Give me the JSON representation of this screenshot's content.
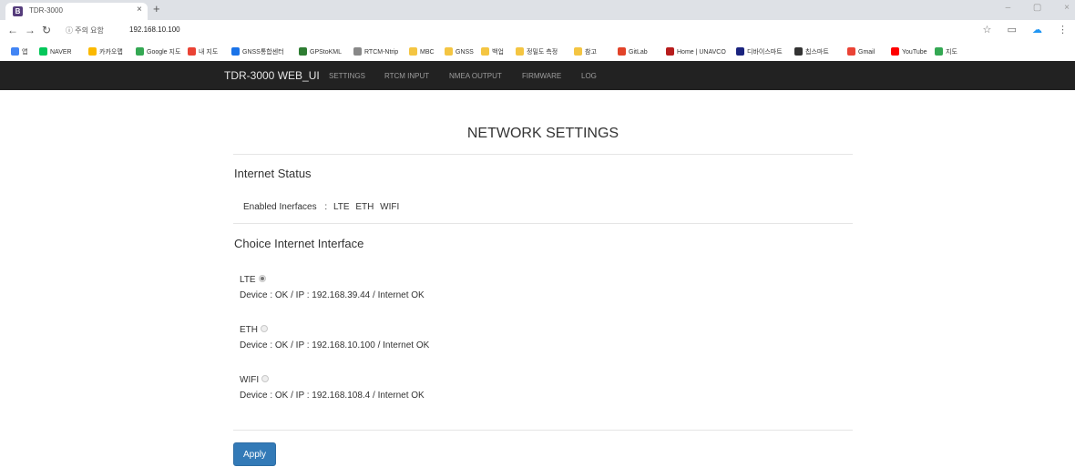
{
  "browser": {
    "tab_title": "TDR-3000",
    "tab_favicon": "B",
    "tab_close": "×",
    "new_tab": "+",
    "window_controls": [
      "–",
      "▢",
      "×"
    ],
    "security_label": "ⓘ 주의 요함",
    "url": "192.168.10.100",
    "bookmarks": [
      {
        "label": "앱",
        "color": "#4285f4"
      },
      {
        "label": "NAVER",
        "color": "#03c75a"
      },
      {
        "label": "카카오맵",
        "color": "#fbb900"
      },
      {
        "label": "Google 지도",
        "color": "#34a853"
      },
      {
        "label": "내 지도",
        "color": "#ea4335"
      },
      {
        "label": "GNSS통합센터",
        "color": "#1a73e8"
      },
      {
        "label": "GPStoKML",
        "color": "#2e7d32"
      },
      {
        "label": "RTCM-Ntrip",
        "color": "#888888"
      },
      {
        "label": "MBC",
        "color": "#f4c542"
      },
      {
        "label": "GNSS",
        "color": "#f4c542"
      },
      {
        "label": "백업",
        "color": "#f4c542"
      },
      {
        "label": "정밀도 측정",
        "color": "#f4c542"
      },
      {
        "label": "참고",
        "color": "#f4c542"
      },
      {
        "label": "GitLab",
        "color": "#e24329"
      },
      {
        "label": "Home | UNAVCO",
        "color": "#b71c1c"
      },
      {
        "label": "디바이스마트",
        "color": "#1a237e"
      },
      {
        "label": "칩스마트",
        "color": "#333333"
      },
      {
        "label": "Gmail",
        "color": "#ea4335"
      },
      {
        "label": "YouTube",
        "color": "#ff0000"
      },
      {
        "label": "지도",
        "color": "#34a853"
      }
    ]
  },
  "navbar": {
    "brand": "TDR-3000 WEB_UI",
    "links": [
      "SETTINGS",
      "RTCM INPUT",
      "NMEA OUTPUT",
      "FIRMWARE",
      "LOG"
    ]
  },
  "page": {
    "title": "NETWORK SETTINGS",
    "internet_status": {
      "heading": "Internet Status",
      "enabled_label": "Enabled Inerfaces",
      "separator": ":",
      "interfaces": [
        "LTE",
        "ETH",
        "WIFI"
      ]
    },
    "choice": {
      "heading": "Choice Internet Interface",
      "options": [
        {
          "name": "LTE",
          "checked": true,
          "detail": "Device : OK  /  IP : 192.168.39.44  /  Internet OK"
        },
        {
          "name": "ETH",
          "checked": false,
          "detail": "Device : OK  /  IP : 192.168.10.100  /  Internet OK"
        },
        {
          "name": "WIFI",
          "checked": false,
          "detail": "Device : OK  /  IP : 192.168.108.4  /  Internet OK"
        }
      ]
    },
    "apply_label": "Apply"
  }
}
